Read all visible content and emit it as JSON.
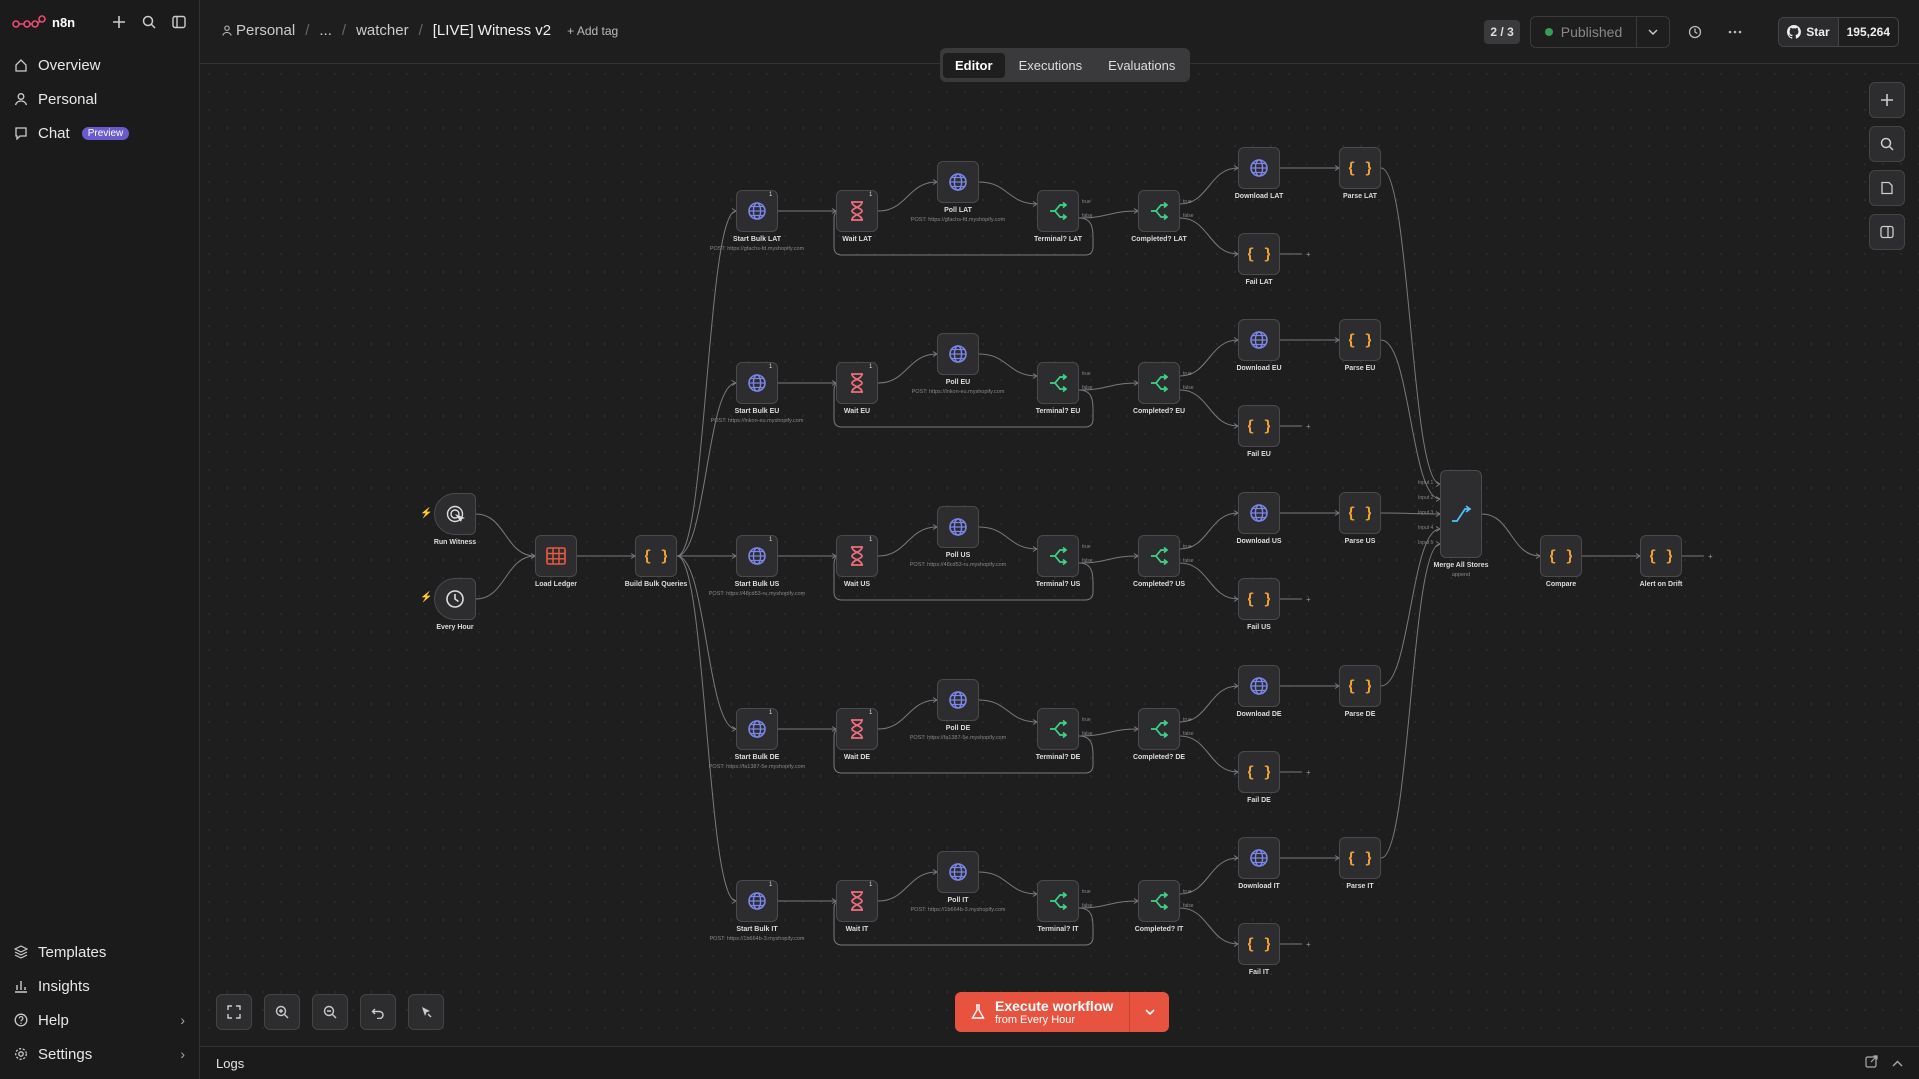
{
  "app": {
    "name": "n8n"
  },
  "sidebar": {
    "items": [
      {
        "label": "Overview"
      },
      {
        "label": "Personal"
      },
      {
        "label": "Chat",
        "badge": "Preview"
      }
    ],
    "bottom": [
      {
        "label": "Templates"
      },
      {
        "label": "Insights"
      },
      {
        "label": "Help"
      },
      {
        "label": "Settings"
      }
    ]
  },
  "header": {
    "breadcrumb": [
      "Personal",
      "...",
      "watcher"
    ],
    "title": "[LIVE] Witness v2",
    "add_tag": "+ Add tag",
    "version_counter": "2 / 3",
    "status": "Published",
    "github_label": "Star",
    "github_count": "195,264"
  },
  "tabs": [
    {
      "label": "Editor",
      "active": true
    },
    {
      "label": "Executions"
    },
    {
      "label": "Evaluations"
    }
  ],
  "execute": {
    "label": "Execute workflow",
    "sub": "from Every Hour"
  },
  "logs": {
    "label": "Logs"
  },
  "accent": "#e8533f",
  "nodes": {
    "run_witness": "Run Witness",
    "every_hour": "Every Hour",
    "load_ledger": "Load Ledger",
    "build_bulk": "Build Bulk Queries",
    "merge": "Merge All Stores",
    "merge_sub": "append",
    "compare": "Compare",
    "alert": "Alert on Drift",
    "input_labels": [
      "Input 1",
      "Input 2",
      "Input 3",
      "Input 4",
      "Input 5"
    ],
    "port_true": "true",
    "port_false": "false",
    "run_count": "1",
    "rows": [
      {
        "start": "Start Bulk LAT",
        "start_sub": "POST: https://gfachs-fd.myshopify.com",
        "wait": "Wait LAT",
        "poll": "Poll LAT",
        "poll_sub": "POST: https://gfachs-fd.myshopify.com",
        "terminal": "Terminal? LAT",
        "completed": "Completed? LAT",
        "download": "Download LAT",
        "parse": "Parse LAT",
        "fail": "Fail LAT"
      },
      {
        "start": "Start Bulk EU",
        "start_sub": "POST: https://lnkon-eu.myshopify.com",
        "wait": "Wait EU",
        "poll": "Poll EU",
        "poll_sub": "POST: https://lnkon-eu.myshopify.com",
        "terminal": "Terminal? EU",
        "completed": "Completed? EU",
        "download": "Download EU",
        "parse": "Parse EU",
        "fail": "Fail EU"
      },
      {
        "start": "Start Bulk US",
        "start_sub": "POST: https://48cd53-ru.myshopify.com",
        "wait": "Wait US",
        "poll": "Poll US",
        "poll_sub": "POST: https://48cd53-ru.myshopify.com",
        "terminal": "Terminal? US",
        "completed": "Completed? US",
        "download": "Download US",
        "parse": "Parse US",
        "fail": "Fail US"
      },
      {
        "start": "Start Bulk DE",
        "start_sub": "POST: https://fa1387-5e.myshopify.com",
        "wait": "Wait DE",
        "poll": "Poll DE",
        "poll_sub": "POST: https://fa1387-5e.myshopify.com",
        "terminal": "Terminal? DE",
        "completed": "Completed? DE",
        "download": "Download DE",
        "parse": "Parse DE",
        "fail": "Fail DE"
      },
      {
        "start": "Start Bulk IT",
        "start_sub": "POST: https://1b664b-3.myshopify.com",
        "wait": "Wait IT",
        "poll": "Poll IT",
        "poll_sub": "POST: https://1b664b-3.myshopify.com",
        "terminal": "Terminal? IT",
        "completed": "Completed? IT",
        "download": "Download IT",
        "parse": "Parse IT",
        "fail": "Fail IT"
      }
    ]
  }
}
